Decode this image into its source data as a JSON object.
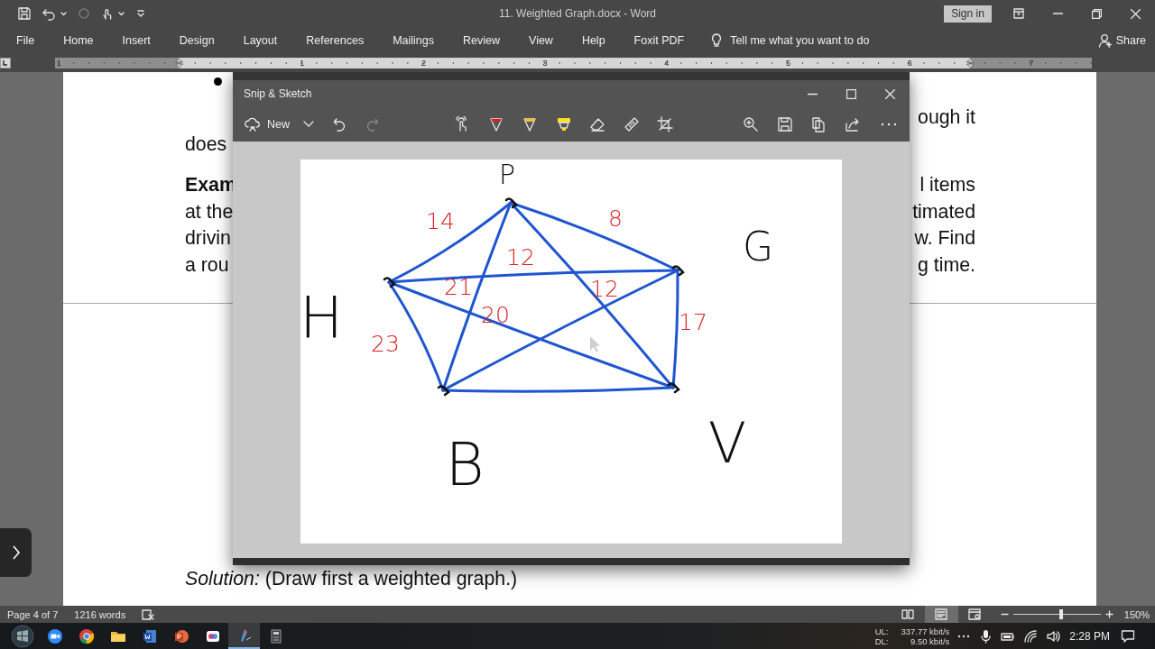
{
  "word": {
    "title": "11. Weighted Graph.docx  -  Word",
    "sign_in": "Sign in",
    "tabs": [
      {
        "label": "File",
        "selected": false
      },
      {
        "label": "Home",
        "selected": false
      },
      {
        "label": "Insert",
        "selected": false
      },
      {
        "label": "Design",
        "selected": false
      },
      {
        "label": "Layout",
        "selected": false
      },
      {
        "label": "References",
        "selected": false
      },
      {
        "label": "Mailings",
        "selected": false
      },
      {
        "label": "Review",
        "selected": false
      },
      {
        "label": "View",
        "selected": false
      },
      {
        "label": "Help",
        "selected": false
      },
      {
        "label": "Foxit PDF",
        "selected": false
      }
    ],
    "tell_me": "Tell me what you want to do",
    "share": "Share",
    "ruler": [
      "1",
      "1",
      "2",
      "3",
      "4",
      "5",
      "6",
      "7"
    ]
  },
  "document": {
    "paragraphs": [
      {
        "kind": "bullet"
      },
      {
        "kind": "text",
        "lines": [
          {
            "right": "ough it"
          },
          {
            "left": "does",
            "bold": false
          }
        ]
      },
      {
        "kind": "text",
        "lines": [
          {
            "left": "Exam",
            "bold": true,
            "right": "l items"
          },
          {
            "left": "at the",
            "bold": false,
            "right": "timated"
          },
          {
            "left": "drivin",
            "bold": false,
            "right": "w. Find"
          },
          {
            "left": "a rou",
            "bold": false,
            "right": "g time."
          }
        ]
      }
    ],
    "solution": "*Solution:* (Draw first a weighted graph.)"
  },
  "snip": {
    "title": "Snip & Sketch",
    "new_button": "New",
    "drawing": {
      "vertex_labels": [
        "P",
        "G",
        "H",
        "V",
        "B"
      ],
      "weights": [
        "14",
        "8",
        "12",
        "21",
        "12",
        "17",
        "20",
        "23"
      ]
    }
  },
  "status_bar": {
    "page": "Page 4 of 7",
    "words": "1216 words",
    "views": [
      {
        "kind": "read",
        "selected": false
      },
      {
        "kind": "print",
        "selected": true
      },
      {
        "kind": "web",
        "selected": false
      }
    ],
    "zoom_slider": {
      "level": 0.55
    },
    "zoom": "150%"
  },
  "taskbar": {
    "apps": [
      {
        "kind": "video",
        "selected": false
      },
      {
        "kind": "browser",
        "selected": false
      },
      {
        "kind": "folder",
        "selected": false
      },
      {
        "kind": "word",
        "selected": false
      },
      {
        "kind": "slides",
        "selected": false
      },
      {
        "kind": "photos",
        "selected": false
      },
      {
        "kind": "sketch",
        "selected": true
      },
      {
        "kind": "calculator",
        "selected": false
      }
    ],
    "upload_label": "UL:",
    "upload": "337.77 kbit/s",
    "download_label": "DL:",
    "download": "9.50 kbit/s",
    "time": "2:28 PM"
  }
}
